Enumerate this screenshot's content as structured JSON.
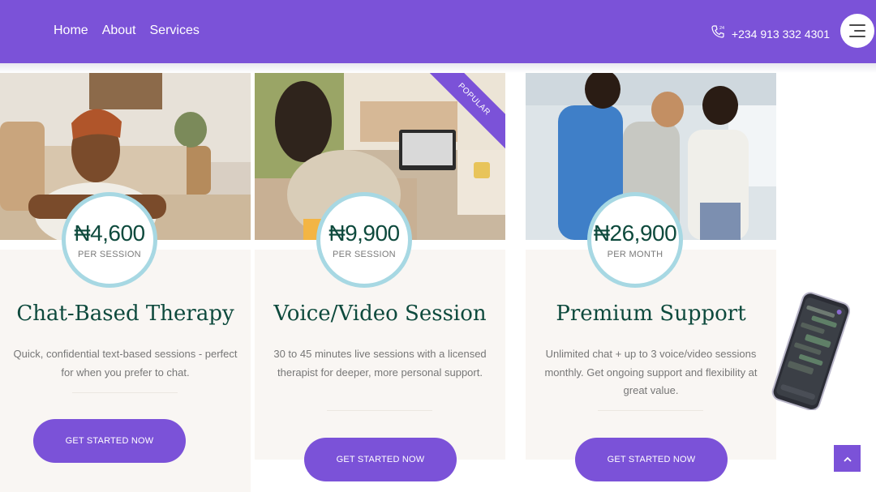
{
  "nav": {
    "items": [
      "Home",
      "About",
      "Services"
    ]
  },
  "contact": {
    "phone": "+234 913 332 4301",
    "icon": "phone-icon"
  },
  "menu": {
    "icon": "hamburger-menu-icon"
  },
  "cards": [
    {
      "price": "₦4,600",
      "unit": "PER SESSION",
      "title": "Chat-Based Therapy",
      "description": "Quick, confidential text-based sessions - perfect for when you prefer to chat.",
      "cta": "GET STARTED NOW"
    },
    {
      "price": "₦9,900",
      "unit": "PER SESSION",
      "title": "Voice/Video Session",
      "description": "30 to 45 minutes live sessions with a licensed therapist for deeper, more personal support.",
      "cta": "GET STARTED NOW",
      "ribbon": "POPULAR"
    },
    {
      "price": "₦26,900",
      "unit": "PER MONTH",
      "title": "Premium Support",
      "description": "Unlimited chat + up to 3 voice/video sessions monthly. Get ongoing support and flexibility at great value.",
      "cta": "GET STARTED NOW"
    }
  ],
  "colors": {
    "brand": "#7b52d8",
    "heading": "#0e4a3d",
    "badge_border": "#a7d8e3",
    "card_bg": "#f9f6f3"
  },
  "scroll_top": {
    "icon": "chevron-up-icon"
  }
}
